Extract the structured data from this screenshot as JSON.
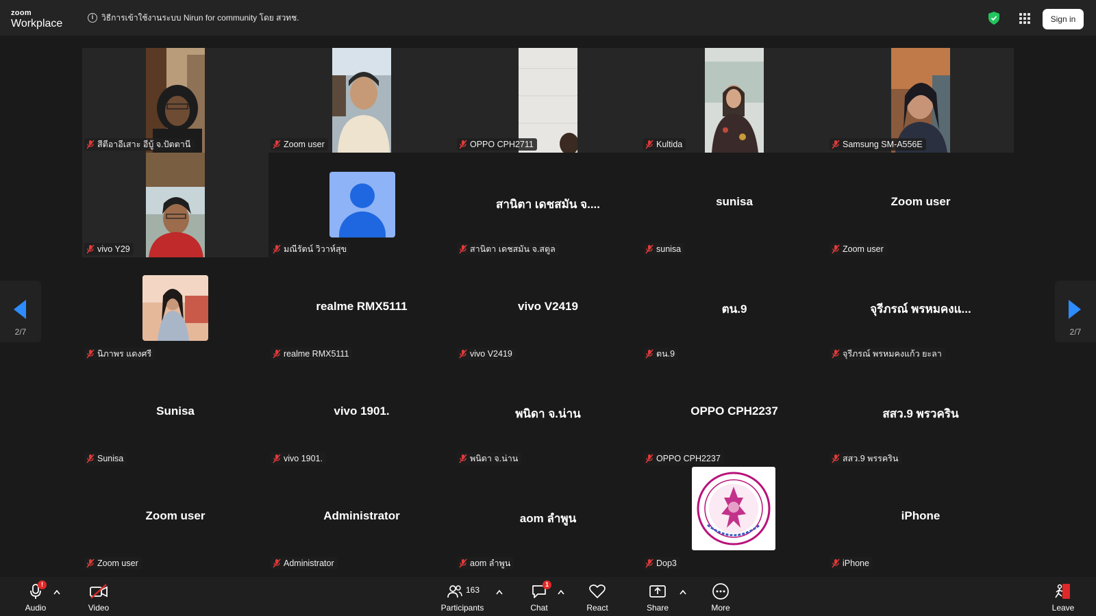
{
  "app": {
    "logo_top": "zoom",
    "logo_bottom": "Workplace",
    "meeting_info": "วิธีการเข้าใช้งานระบบ Nirun for community โดย สวทช.",
    "signin_label": "Sign in"
  },
  "gallery": {
    "tiles": [
      {
        "label": "สีตีอาอีเสาะ อีบู้ จ.ปัตตานี"
      },
      {
        "label": "Zoom user"
      },
      {
        "label": "OPPO CPH2711"
      },
      {
        "label": "Kultida"
      },
      {
        "label": "Samsung SM-A556E"
      },
      {
        "label": "vivo Y29"
      },
      {
        "label": "มณีรัตน์ วิวาห์สุข"
      },
      {
        "label": "สานิตา เดชสมัน จ.สตูล",
        "center": "สานิตา เดชสมัน จ...."
      },
      {
        "label": "sunisa",
        "center": "sunisa"
      },
      {
        "label": "Zoom user",
        "center": "Zoom user"
      },
      {
        "label": "นิภาพร แดงศรี"
      },
      {
        "label": "realme RMX5111",
        "center": "realme RMX5111"
      },
      {
        "label": "vivo V2419",
        "center": "vivo V2419"
      },
      {
        "label": "ตน.9",
        "center": "ตน.9"
      },
      {
        "label": "จุรีภรณ์ พรหมคงแก้ว ยะลา",
        "center": "จุรีภรณ์ พรหมคงแ..."
      },
      {
        "label": "Sunisa",
        "center": "Sunisa"
      },
      {
        "label": "vivo 1901.",
        "center": "vivo 1901."
      },
      {
        "label": "พนิดา จ.น่าน",
        "center": "พนิดา จ.น่าน"
      },
      {
        "label": "OPPO CPH2237",
        "center": "OPPO CPH2237"
      },
      {
        "label": "สสว.9 พรรคริน",
        "center": "สสว.9 พรวคริน"
      },
      {
        "label": "Zoom user",
        "center": "Zoom user"
      },
      {
        "label": "Administrator",
        "center": "Administrator"
      },
      {
        "label": "aom ลำพูน",
        "center": "aom ลำพูน"
      },
      {
        "label": "Dop3"
      },
      {
        "label": "iPhone",
        "center": "iPhone"
      }
    ],
    "page_left": "2/7",
    "page_right": "2/7"
  },
  "toolbar": {
    "audio_label": "Audio",
    "video_label": "Video",
    "participants_label": "Participants",
    "participants_count": "163",
    "chat_label": "Chat",
    "chat_badge": "1",
    "audio_badge": "!",
    "react_label": "React",
    "share_label": "Share",
    "more_label": "More",
    "leave_label": "Leave"
  },
  "colors": {
    "topbar": "#242424",
    "background": "#1a1a1a",
    "accent_blue": "#1f67e0",
    "badge_red": "#e02828",
    "shield_green": "#22c55e",
    "seal_magenta": "#b8127a"
  }
}
